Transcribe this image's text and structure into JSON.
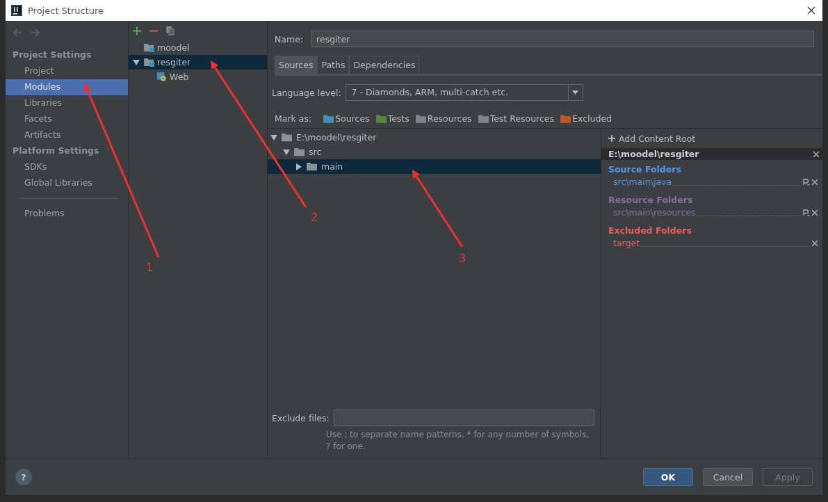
{
  "window": {
    "title": "Project Structure"
  },
  "sidebar": {
    "sections": [
      {
        "heading": "Project Settings",
        "items": [
          {
            "label": "Project",
            "selected": false
          },
          {
            "label": "Modules",
            "selected": true
          },
          {
            "label": "Libraries",
            "selected": false
          },
          {
            "label": "Facets",
            "selected": false
          },
          {
            "label": "Artifacts",
            "selected": false
          }
        ]
      },
      {
        "heading": "Platform Settings",
        "items": [
          {
            "label": "SDKs",
            "selected": false
          },
          {
            "label": "Global Libraries",
            "selected": false
          }
        ]
      }
    ],
    "extra_items": [
      {
        "label": "Problems",
        "selected": false
      }
    ]
  },
  "module_tree": [
    {
      "label": "moodel",
      "kind": "module",
      "selected": false
    },
    {
      "label": "resgiter",
      "kind": "module",
      "selected": true,
      "expanded": true,
      "children": [
        {
          "label": "Web",
          "kind": "facet",
          "selected": false
        }
      ]
    }
  ],
  "name_field": {
    "label": "Name:",
    "value": "resgiter"
  },
  "tabs": [
    {
      "label": "Sources",
      "selected": true
    },
    {
      "label": "Paths",
      "selected": false
    },
    {
      "label": "Dependencies",
      "selected": false
    }
  ],
  "language_level": {
    "label": "Language level:",
    "value": "7 - Diamonds, ARM, multi-catch etc."
  },
  "mark_as": {
    "label": "Mark as:",
    "options": [
      {
        "label": "Sources",
        "color": "#3d8fb3"
      },
      {
        "label": "Tests",
        "color": "#4f8a3a"
      },
      {
        "label": "Resources",
        "color": "#7d8489"
      },
      {
        "label": "Test Resources",
        "color": "#7d8489"
      },
      {
        "label": "Excluded",
        "color": "#c0562a"
      }
    ]
  },
  "content_tree": [
    {
      "label": "E:\\moodel\\resgiter",
      "expanded": true,
      "selected": false,
      "children": [
        {
          "label": "src",
          "expanded": true,
          "selected": false,
          "children": [
            {
              "label": "main",
              "expanded": false,
              "selected": true
            }
          ]
        }
      ]
    }
  ],
  "content_root": {
    "add_label": "Add Content Root",
    "path": "E:\\moodel\\resgiter",
    "groups": [
      {
        "title": "Source Folders",
        "color": "#5394ec",
        "folders": [
          {
            "path": "src\\main\\java",
            "has_prefix": true
          }
        ]
      },
      {
        "title": "Resource Folders",
        "color": "#8a6aa5",
        "folders": [
          {
            "path": "src\\main\\resources",
            "has_prefix": true
          }
        ]
      },
      {
        "title": "Excluded Folders",
        "color": "#ee5c5c",
        "folders": [
          {
            "path": "target",
            "has_prefix": false
          }
        ]
      }
    ]
  },
  "exclude_files": {
    "label": "Exclude files:",
    "hint": "Use ; to separate name patterns, * for any number of symbols, ? for one."
  },
  "help": {
    "label": "?"
  },
  "buttons": [
    {
      "label": "OK",
      "kind": "primary"
    },
    {
      "label": "Cancel",
      "kind": "normal"
    },
    {
      "label": "Apply",
      "kind": "disabled"
    }
  ],
  "annotations": [
    {
      "label": "1"
    },
    {
      "label": "2"
    },
    {
      "label": "3"
    }
  ]
}
